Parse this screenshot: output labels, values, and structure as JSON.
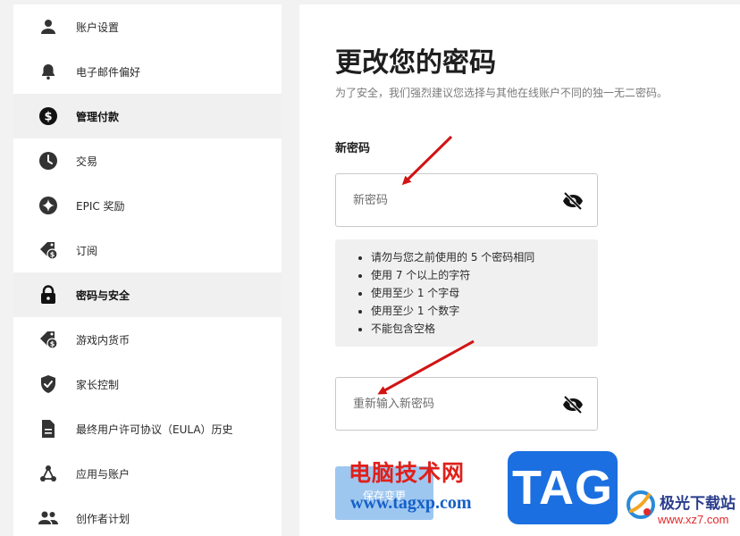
{
  "sidebar": {
    "items": [
      {
        "label": "账户设置",
        "icon": "user-icon",
        "active": false
      },
      {
        "label": "电子邮件偏好",
        "icon": "bell-icon",
        "active": false
      },
      {
        "label": "管理付款",
        "icon": "dollar-icon",
        "active": true
      },
      {
        "label": "交易",
        "icon": "clock-icon",
        "active": false
      },
      {
        "label": "EPIC 奖励",
        "icon": "sparkle-icon",
        "active": false
      },
      {
        "label": "订阅",
        "icon": "tag-dollar-icon",
        "active": false
      },
      {
        "label": "密码与安全",
        "icon": "lock-icon",
        "active": true
      },
      {
        "label": "游戏内货币",
        "icon": "tag-coin-icon",
        "active": false
      },
      {
        "label": "家长控制",
        "icon": "shield-check-icon",
        "active": false
      },
      {
        "label": "最终用户许可协议（EULA）历史",
        "icon": "document-icon",
        "active": false
      },
      {
        "label": "应用与账户",
        "icon": "connections-icon",
        "active": false
      },
      {
        "label": "创作者计划",
        "icon": "people-icon",
        "active": false
      }
    ]
  },
  "main": {
    "title": "更改您的密码",
    "subtitle": "为了安全，我们强烈建议您选择与其他在线账户不同的独一无二密码。",
    "new_password_label": "新密码",
    "new_password_placeholder": "新密码",
    "rules": [
      "请勿与您之前使用的 5 个密码相同",
      "使用 7 个以上的字符",
      "使用至少 1 个字母",
      "使用至少 1 个数字",
      "不能包含空格"
    ],
    "confirm_password_placeholder": "重新输入新密码",
    "save_label": "保存变更"
  },
  "watermark": {
    "site_name": "电脑技术网",
    "site_url": "www.tagxp.com",
    "tag_logo": "TAG",
    "jg_name": "极光下载站",
    "jg_url": "www.xz7.com"
  },
  "colors": {
    "accent_button": "#9ec7f0",
    "arrow": "#d21414",
    "active_item_bg": "#f0f0f0"
  }
}
